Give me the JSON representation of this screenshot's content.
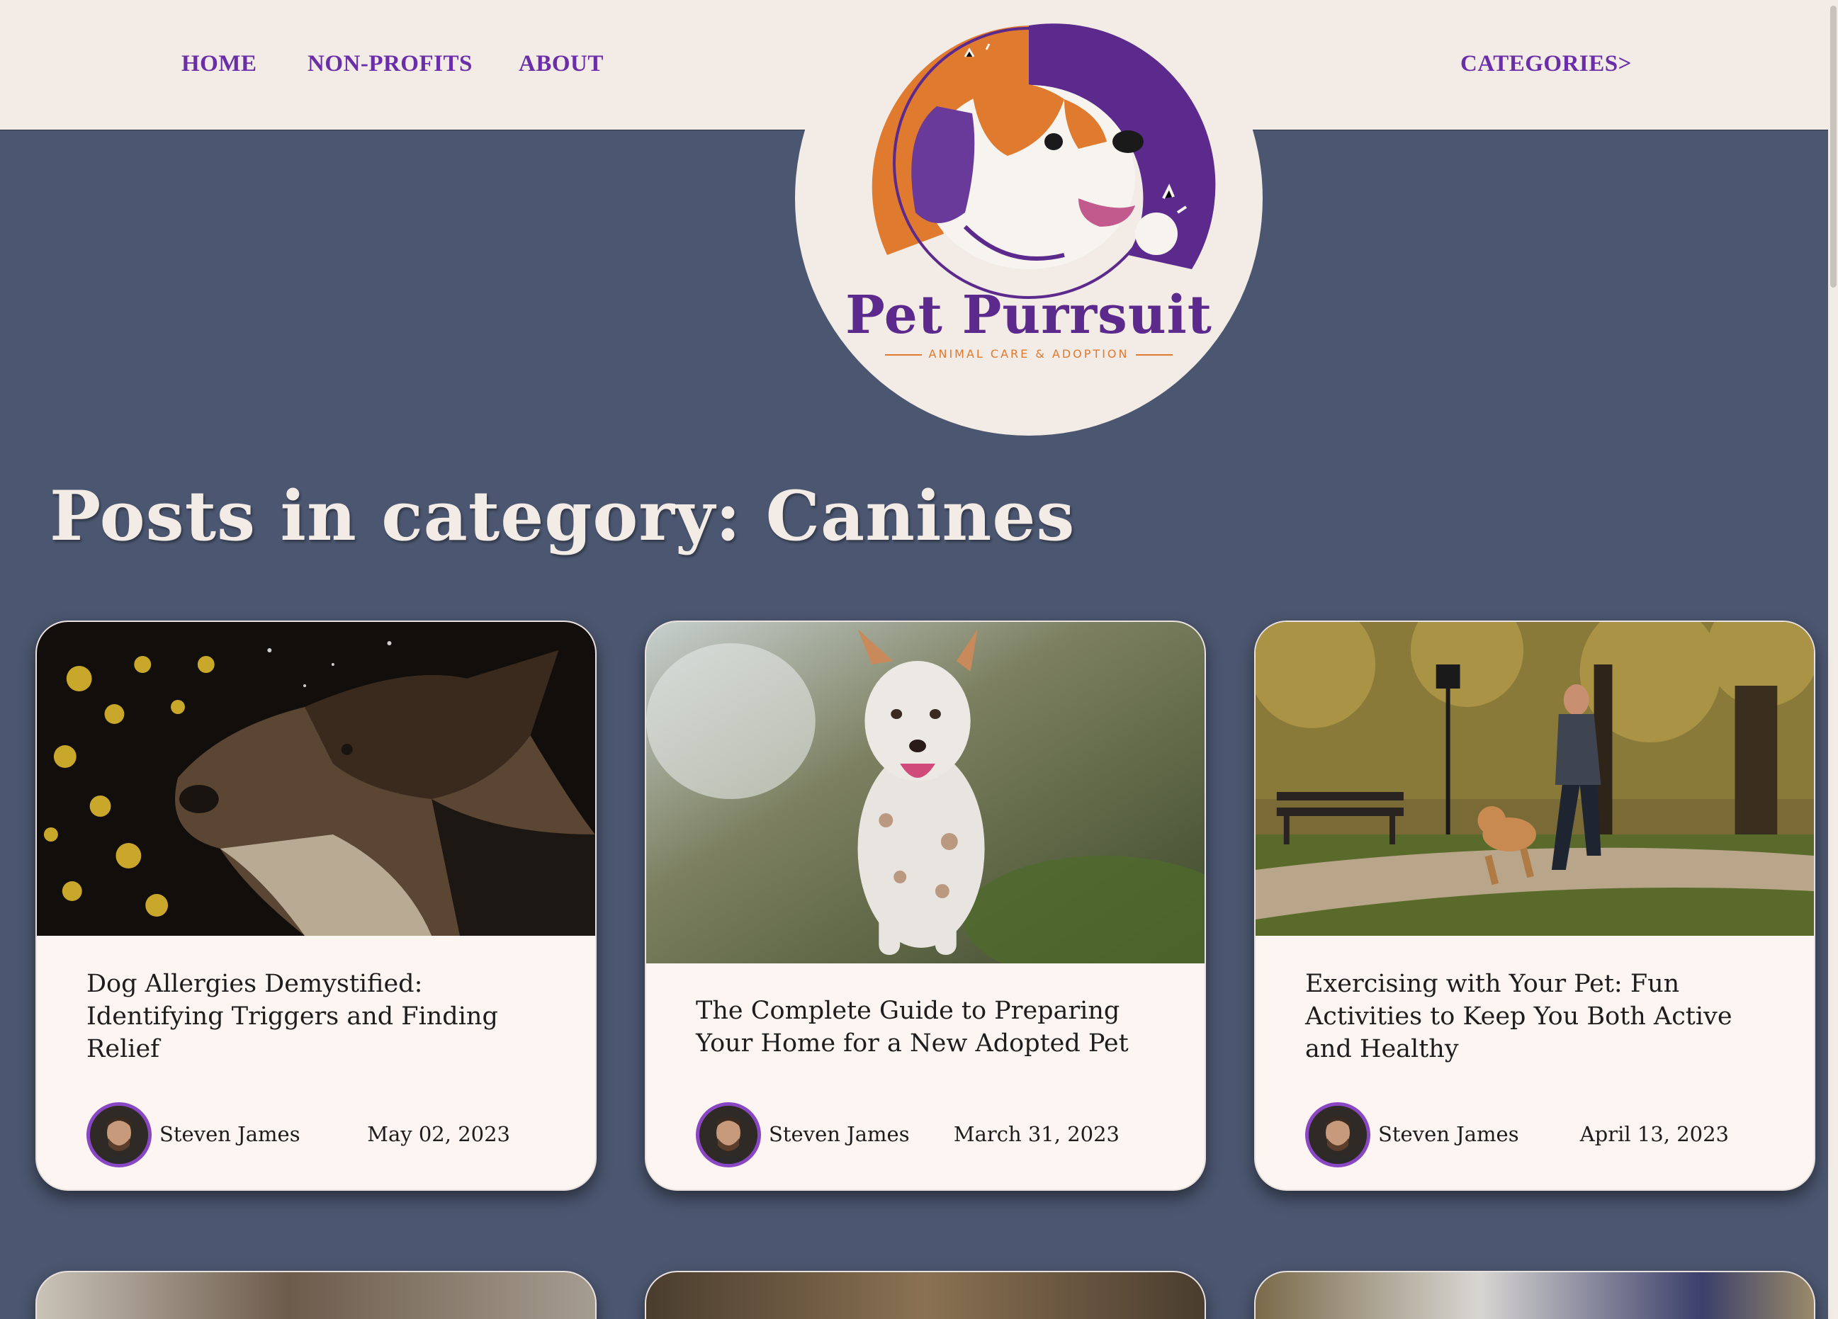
{
  "nav": {
    "home": "HOME",
    "non_profits": "NON-PROFITS",
    "about": "ABOUT",
    "categories": "CATEGORIES>"
  },
  "logo": {
    "title": "Pet Purrsuit",
    "tagline": "ANIMAL CARE & ADOPTION"
  },
  "page": {
    "title": "Posts in category: Canines"
  },
  "posts": [
    {
      "title": "Dog Allergies Demystified: Identifying Triggers and Finding Relief",
      "author": "Steven James",
      "date": "May 02, 2023",
      "image": "dog-profile-photo"
    },
    {
      "title": "The Complete Guide to Preparing Your Home for a New Adopted Pet",
      "author": "Steven James",
      "date": "March 31, 2023",
      "image": "running-dog-photo"
    },
    {
      "title": "Exercising with Your Pet: Fun Activities to Keep You Both Active and Healthy",
      "author": "Steven James",
      "date": "April 13, 2023",
      "image": "woman-jogging-with-dog-photo"
    }
  ],
  "colors": {
    "background": "#4b5670",
    "header": "#f2ebe6",
    "nav_text": "#6a2fa8",
    "card": "#fdf5f2",
    "avatar_ring": "#8a47c4",
    "logo_orange": "#e07a2e",
    "logo_purple": "#5b2a8c"
  }
}
